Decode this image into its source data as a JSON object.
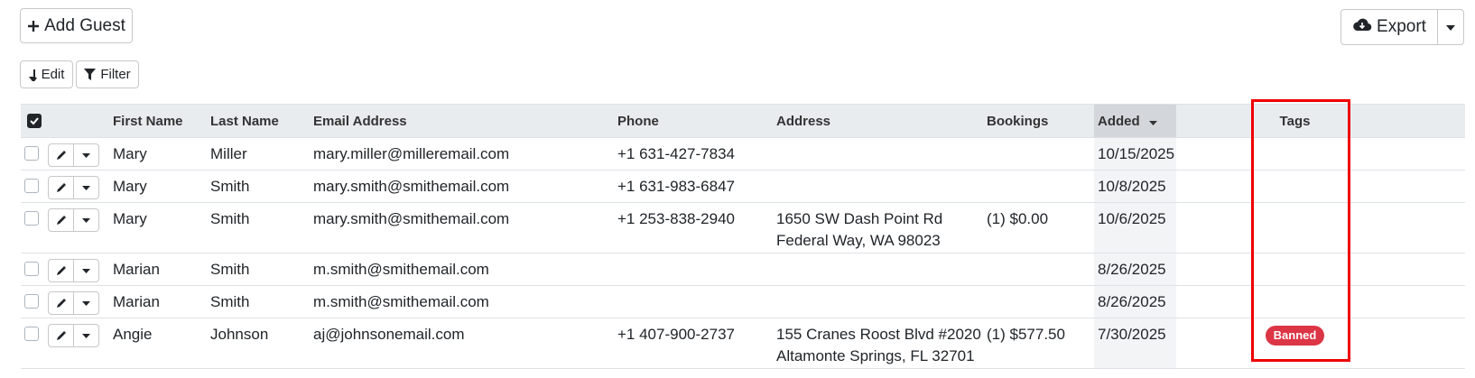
{
  "toolbar": {
    "add_guest_label": "Add Guest",
    "export_label": "Export",
    "edit_label": "Edit",
    "filter_label": "Filter"
  },
  "table": {
    "headers": {
      "first_name": "First Name",
      "last_name": "Last Name",
      "email": "Email Address",
      "phone": "Phone",
      "address": "Address",
      "bookings": "Bookings",
      "added": "Added",
      "tags": "Tags"
    },
    "sorted_column": "Added",
    "sort_direction": "descending",
    "rows": [
      {
        "first": "Mary",
        "last": "Miller",
        "email": "mary.miller@milleremail.com",
        "phone": "+1 631-427-7834",
        "address1": "",
        "address2": "",
        "bookings": "",
        "added": "10/15/2025",
        "tag": ""
      },
      {
        "first": "Mary",
        "last": "Smith",
        "email": "mary.smith@smithemail.com",
        "phone": "+1 631-983-6847",
        "address1": "",
        "address2": "",
        "bookings": "",
        "added": "10/8/2025",
        "tag": ""
      },
      {
        "first": "Mary",
        "last": "Smith",
        "email": "mary.smith@smithemail.com",
        "phone": "+1 253-838-2940",
        "address1": "1650 SW Dash Point Rd",
        "address2": "Federal Way, WA 98023",
        "bookings": "(1) $0.00",
        "added": "10/6/2025",
        "tag": ""
      },
      {
        "first": "Marian",
        "last": "Smith",
        "email": "m.smith@smithemail.com",
        "phone": "",
        "address1": "",
        "address2": "",
        "bookings": "",
        "added": "8/26/2025",
        "tag": ""
      },
      {
        "first": "Marian",
        "last": "Smith",
        "email": "m.smith@smithemail.com",
        "phone": "",
        "address1": "",
        "address2": "",
        "bookings": "",
        "added": "8/26/2025",
        "tag": ""
      },
      {
        "first": "Angie",
        "last": "Johnson",
        "email": "aj@johnsonemail.com",
        "phone": "+1 407-900-2737",
        "address1": "155 Cranes Roost Blvd #2020",
        "address2": "Altamonte Springs, FL 32701",
        "bookings": "(1) $577.50",
        "added": "7/30/2025",
        "tag": "Banned"
      }
    ]
  },
  "colors": {
    "badge_banned": "#dc3545",
    "highlight": "#ee0000",
    "header_bg": "#e9ecef"
  },
  "icons": [
    "plus-icon",
    "cloud-download-icon",
    "caret-down-icon",
    "pencil-icon",
    "filter-icon",
    "edit-arrow-icon"
  ]
}
